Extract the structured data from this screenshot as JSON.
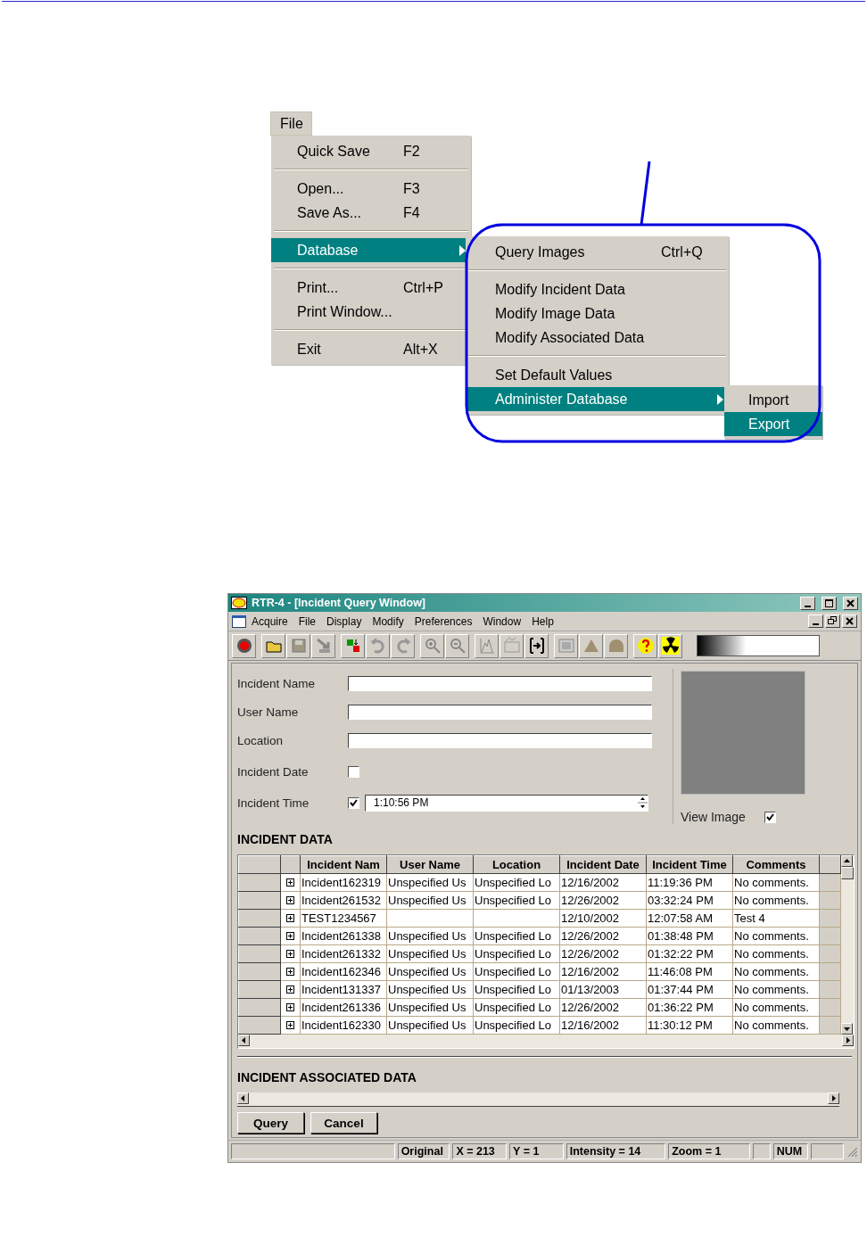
{
  "menu_figure": {
    "menu_title": "File",
    "menu": [
      {
        "kind": "item",
        "label": "Quick Save",
        "shortcut": "F2",
        "selected": false
      },
      {
        "kind": "separator"
      },
      {
        "kind": "item",
        "label": "Open...",
        "shortcut": "F3",
        "selected": false
      },
      {
        "kind": "item",
        "label": "Save As...",
        "shortcut": "F4",
        "selected": false
      },
      {
        "kind": "separator"
      },
      {
        "kind": "submenu",
        "label": "Database",
        "selected": true
      },
      {
        "kind": "separator"
      },
      {
        "kind": "item",
        "label": "Print...",
        "shortcut": "Ctrl+P",
        "selected": false
      },
      {
        "kind": "item",
        "label": "Print Window...",
        "selected": false
      },
      {
        "kind": "separator"
      },
      {
        "kind": "item",
        "label": "Exit",
        "shortcut": "Alt+X",
        "selected": false
      }
    ],
    "submenu": [
      {
        "kind": "item",
        "label": "Query Images",
        "shortcut": "Ctrl+Q",
        "selected": false
      },
      {
        "kind": "separator"
      },
      {
        "kind": "item",
        "label": "Modify Incident Data",
        "selected": false
      },
      {
        "kind": "item",
        "label": "Modify Image Data",
        "selected": false
      },
      {
        "kind": "item",
        "label": "Modify Associated Data",
        "selected": false
      },
      {
        "kind": "separator"
      },
      {
        "kind": "item",
        "label": "Set Default Values",
        "selected": false
      },
      {
        "kind": "submenu",
        "label": "Administer Database",
        "selected": true
      }
    ],
    "subsubmenu": [
      {
        "kind": "item",
        "label": "Import",
        "selected": false
      },
      {
        "kind": "item",
        "label": "Export",
        "selected": true
      }
    ]
  },
  "window": {
    "title": "RTR-4 - [Incident Query Window]",
    "menu_bar": [
      "Acquire",
      "File",
      "Display",
      "Modify",
      "Preferences",
      "Window",
      "Help"
    ],
    "fields": [
      {
        "kind": "text",
        "label": "Incident Name"
      },
      {
        "kind": "text",
        "label": "User Name"
      },
      {
        "kind": "text",
        "label": "Location"
      },
      {
        "kind": "date",
        "label": "Incident Date",
        "checked": false
      },
      {
        "kind": "time",
        "label": "Incident Time",
        "checked": true,
        "value": "1:10:56 PM"
      }
    ],
    "view_image": {
      "label": "View Image",
      "checked": true
    },
    "incident_data": {
      "heading": "INCIDENT DATA",
      "columns": [
        "Incident Nam",
        "User Name",
        "Location",
        "Incident Date",
        "Incident Time",
        "Comments"
      ],
      "rows": [
        [
          "Incident162319",
          "Unspecified Us",
          "Unspecified Lo",
          "12/16/2002",
          "11:19:36 PM",
          "No comments."
        ],
        [
          "Incident261532",
          "Unspecified Us",
          "Unspecified Lo",
          "12/26/2002",
          "03:32:24 PM",
          "No comments."
        ],
        [
          "TEST1234567",
          "",
          "",
          "12/10/2002",
          "12:07:58 AM",
          "Test 4"
        ],
        [
          "Incident261338",
          "Unspecified Us",
          "Unspecified Lo",
          "12/26/2002",
          "01:38:48 PM",
          "No comments."
        ],
        [
          "Incident261332",
          "Unspecified Us",
          "Unspecified Lo",
          "12/26/2002",
          "01:32:22 PM",
          "No comments."
        ],
        [
          "Incident162346",
          "Unspecified Us",
          "Unspecified Lo",
          "12/16/2002",
          "11:46:08 PM",
          "No comments."
        ],
        [
          "Incident131337",
          "Unspecified Us",
          "Unspecified Lo",
          "01/13/2003",
          "01:37:44 PM",
          "No comments."
        ],
        [
          "Incident261336",
          "Unspecified Us",
          "Unspecified Lo",
          "12/26/2002",
          "01:36:22 PM",
          "No comments."
        ],
        [
          "Incident162330",
          "Unspecified Us",
          "Unspecified Lo",
          "12/16/2002",
          "11:30:12 PM",
          "No comments."
        ]
      ]
    },
    "associated_heading": "INCIDENT ASSOCIATED DATA",
    "buttons": [
      "Query",
      "Cancel"
    ],
    "status_bar": [
      {
        "kind": "blank"
      },
      {
        "kind": "text",
        "text": "Original"
      },
      {
        "kind": "text",
        "text": "X = 213"
      },
      {
        "kind": "text",
        "text": "Y = 1"
      },
      {
        "kind": "text",
        "text": "Intensity = 14"
      },
      {
        "kind": "text",
        "text": "Zoom = 1"
      },
      {
        "kind": "blank"
      },
      {
        "kind": "text",
        "text": "NUM"
      },
      {
        "kind": "blank"
      }
    ]
  }
}
